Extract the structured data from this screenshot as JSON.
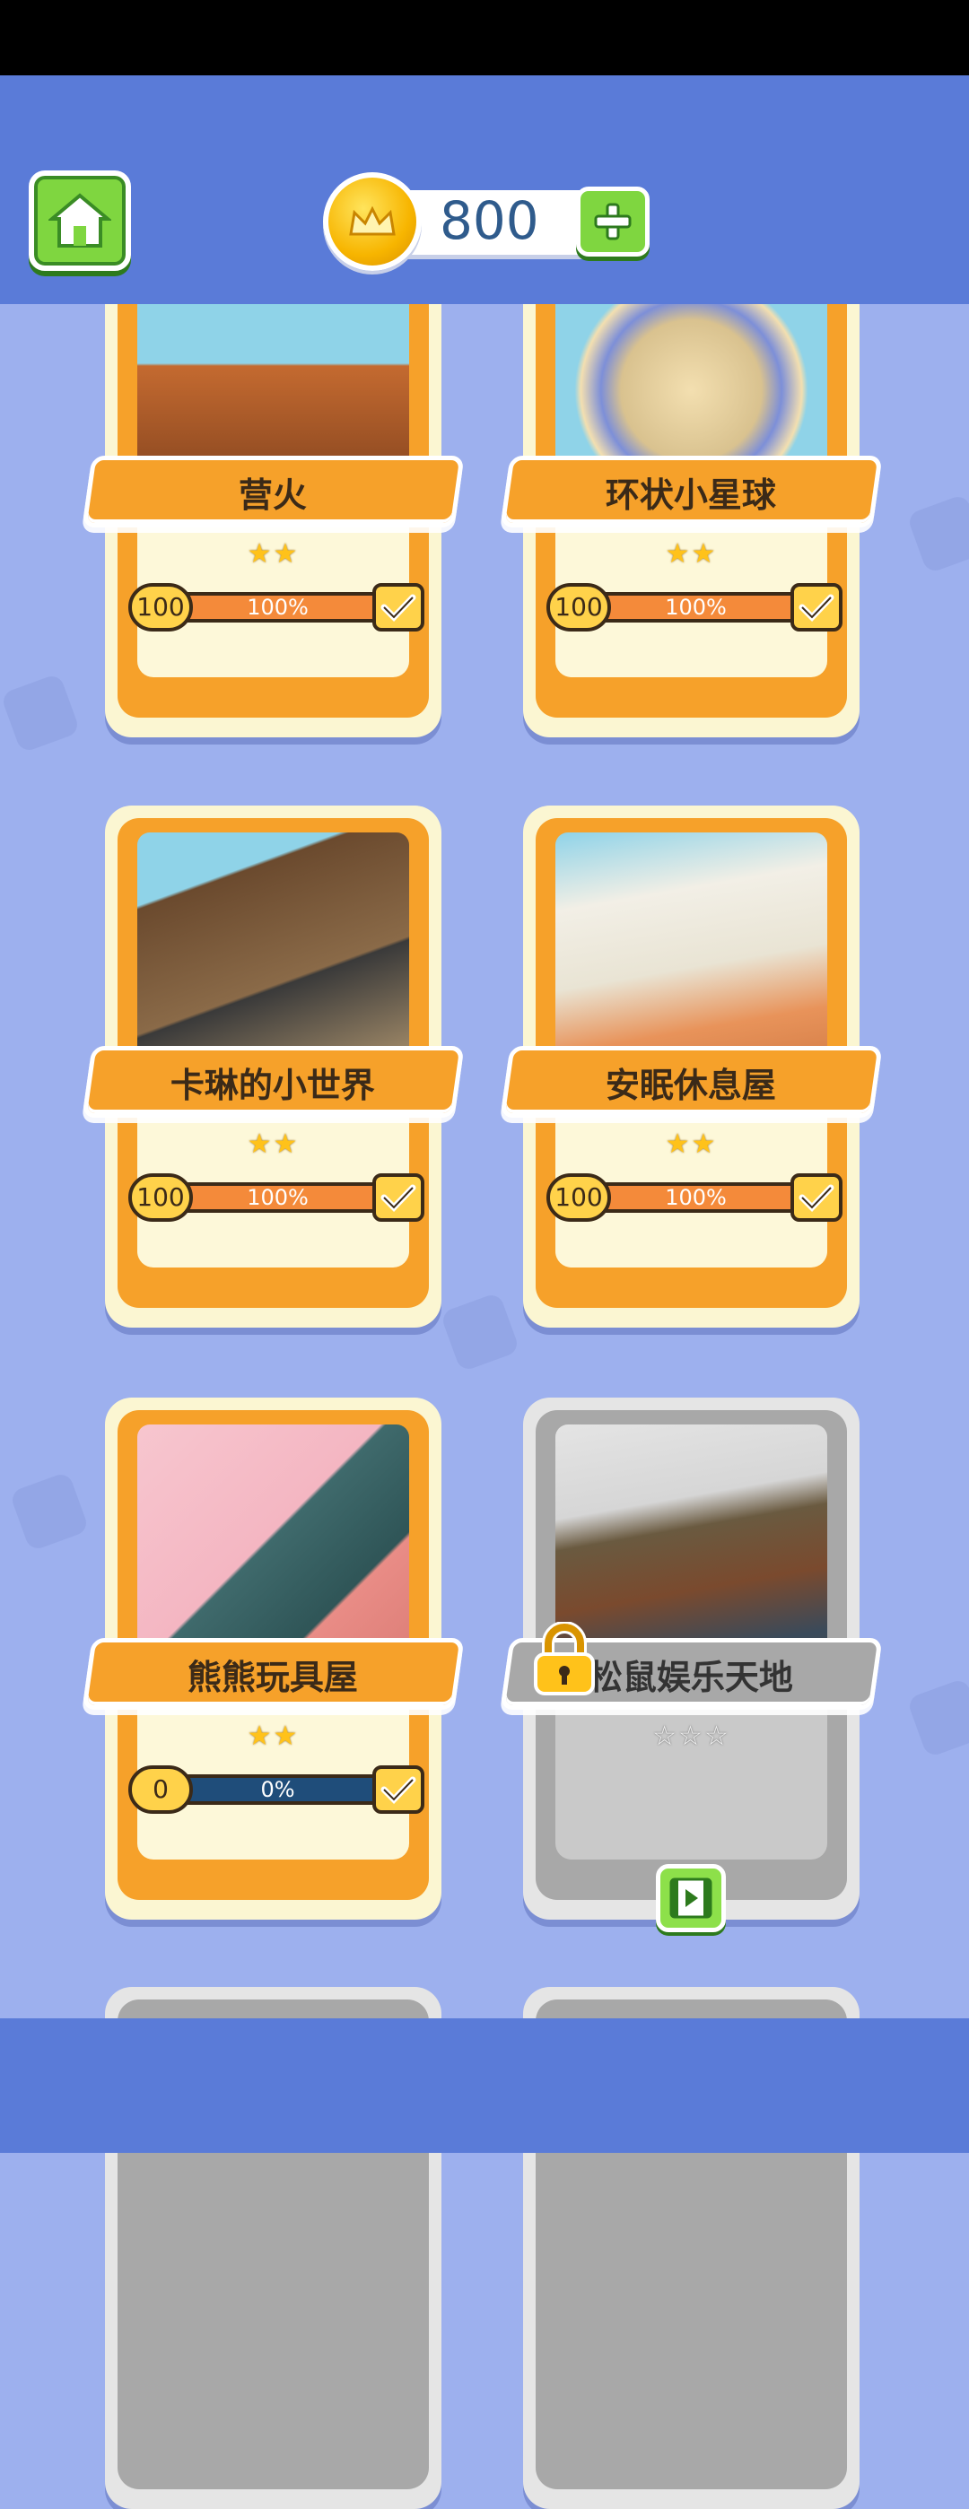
{
  "header": {
    "coins": "800"
  },
  "cards": [
    {
      "title": "营火",
      "stars": "★★",
      "badge": "100",
      "percent": "100%",
      "progress": 1.0,
      "locked": false
    },
    {
      "title": "环状小星球",
      "stars": "★★",
      "badge": "100",
      "percent": "100%",
      "progress": 1.0,
      "locked": false
    },
    {
      "title": "卡琳的小世界",
      "stars": "★★",
      "badge": "100",
      "percent": "100%",
      "progress": 1.0,
      "locked": false
    },
    {
      "title": "安眠休息屋",
      "stars": "★★",
      "badge": "100",
      "percent": "100%",
      "progress": 1.0,
      "locked": false
    },
    {
      "title": "熊熊玩具屋",
      "stars": "★★",
      "badge": "0",
      "percent": "0%",
      "progress": 0.0,
      "locked": false
    },
    {
      "title": "松鼠娱乐天地",
      "stars": "☆☆☆",
      "locked": true
    }
  ],
  "colors": {
    "header_bg": "#5a7bd8",
    "page_bg": "#9db0ee",
    "card_orange": "#f6a12a",
    "card_cream": "#fbf6d2",
    "locked_gray": "#a8a8a8",
    "button_green": "#7fd640"
  },
  "icons": {
    "home": "home-icon",
    "coin": "crown-coin-icon",
    "plus": "plus-icon",
    "check": "check-icon",
    "lock": "lock-icon",
    "video": "video-icon"
  }
}
